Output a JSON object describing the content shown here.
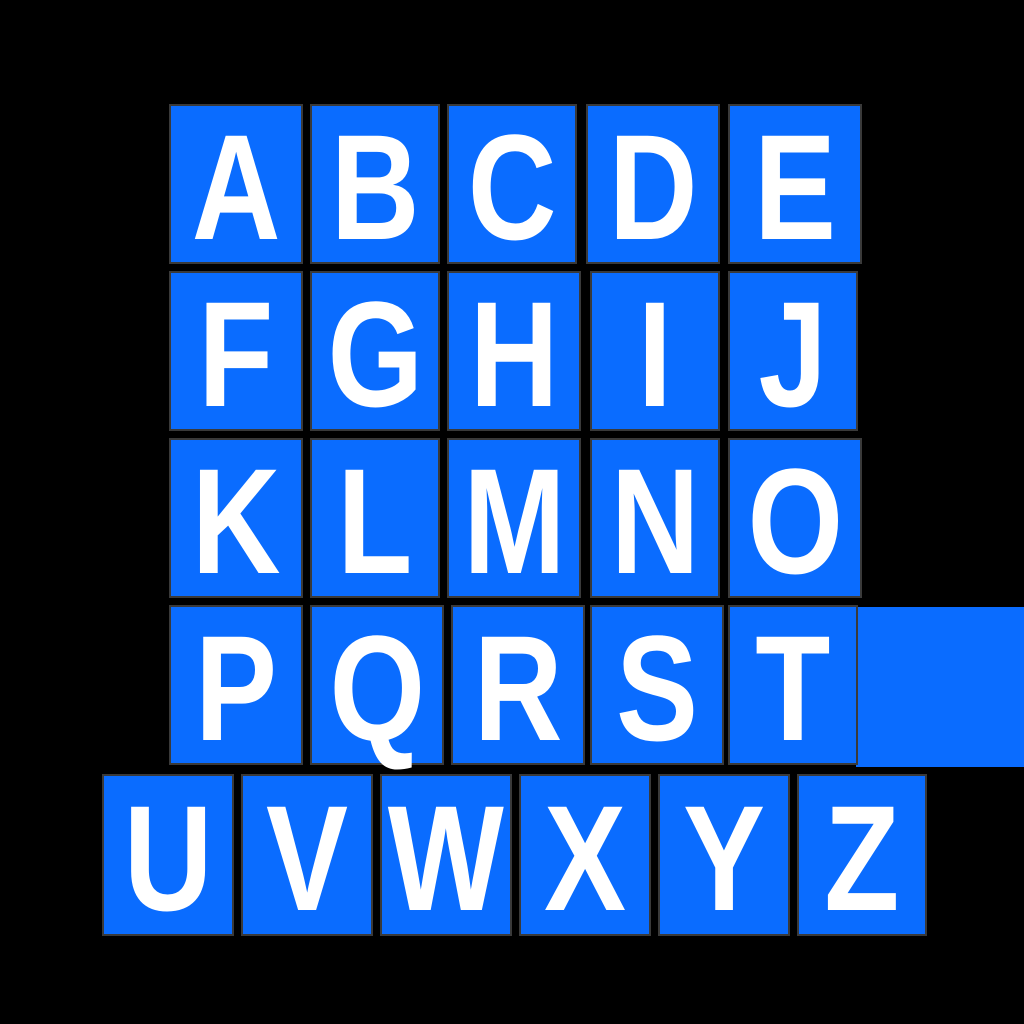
{
  "colors": {
    "background": "#000000",
    "tile": "#0a6cff",
    "letter": "#ffffff",
    "tile_border": "#3a3a3a"
  },
  "letters": [
    "A",
    "B",
    "C",
    "D",
    "E",
    "F",
    "G",
    "H",
    "I",
    "J",
    "K",
    "L",
    "M",
    "N",
    "O",
    "P",
    "Q",
    "R",
    "S",
    "T",
    "U",
    "V",
    "W",
    "X",
    "Y",
    "Z"
  ]
}
